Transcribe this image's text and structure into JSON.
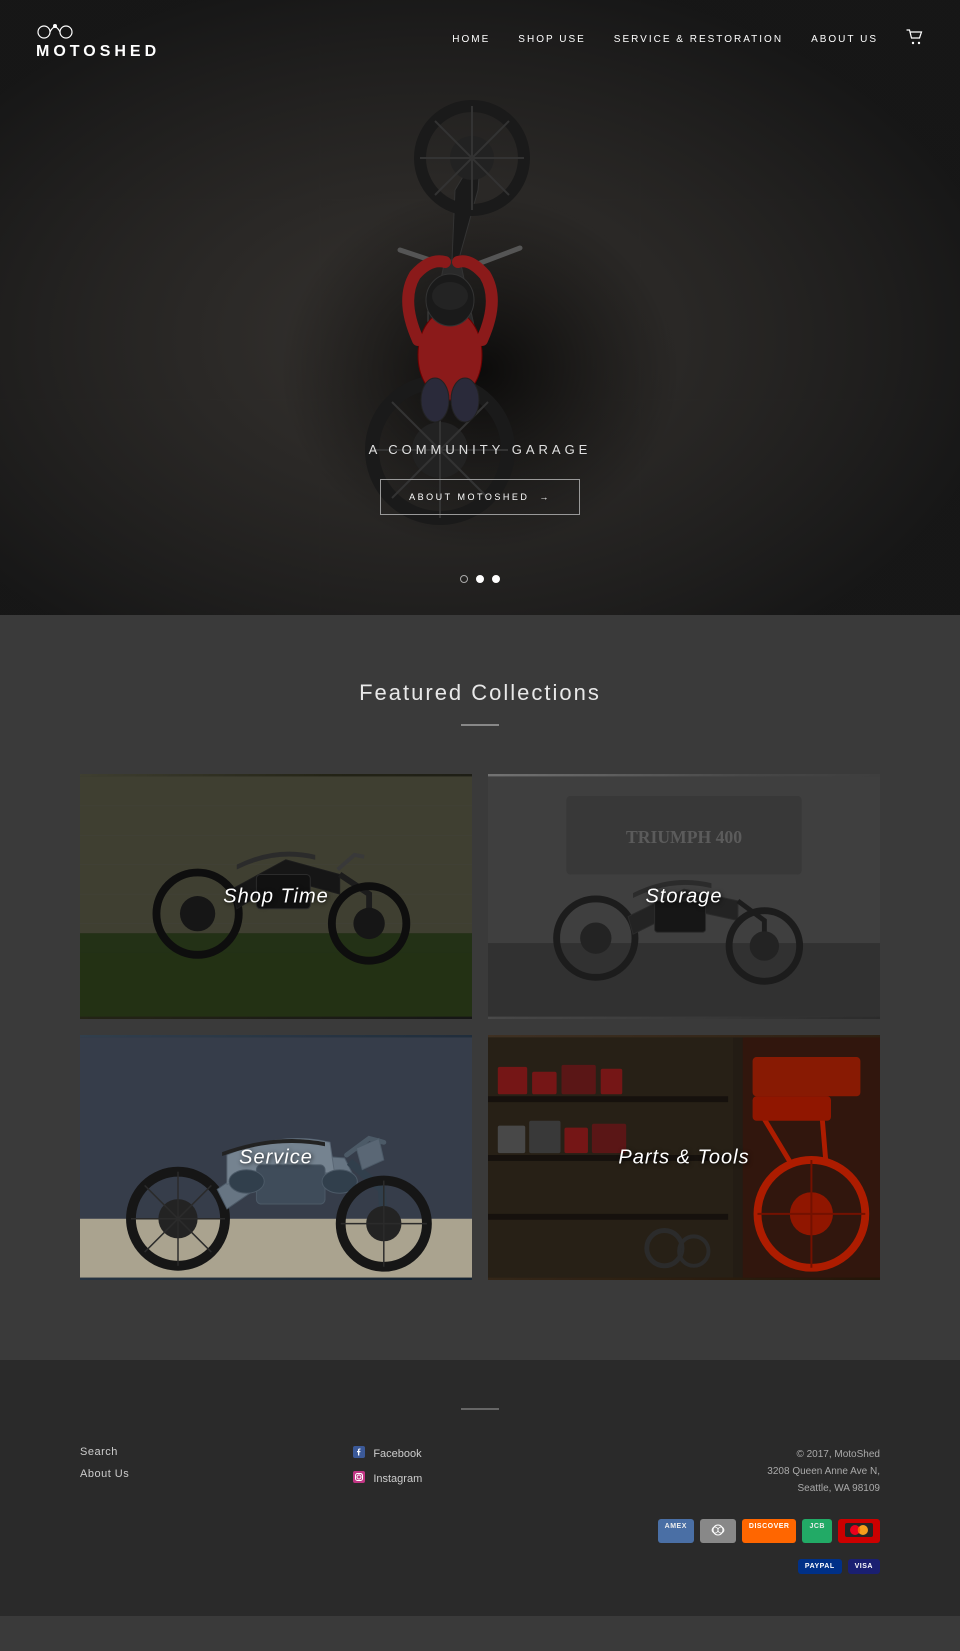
{
  "header": {
    "logo_text": "MOTOSHED",
    "nav": {
      "home": "HOME",
      "shop_use": "SHOP USE",
      "service": "SERVICE & RESTORATION",
      "about": "ABOUT US"
    }
  },
  "hero": {
    "tagline": "A COMMUNITY GARAGE",
    "cta_label": "ABOUT MOTOSHED",
    "cta_arrow": "→",
    "dots": [
      {
        "active": false
      },
      {
        "active": true
      },
      {
        "active": true
      }
    ]
  },
  "collections": {
    "section_title": "Featured Collections",
    "items": [
      {
        "label": "Shop Time",
        "key": "shop-time"
      },
      {
        "label": "Storage",
        "key": "storage"
      },
      {
        "label": "Service",
        "key": "service"
      },
      {
        "label": "Parts & Tools",
        "key": "parts-tools"
      }
    ]
  },
  "footer": {
    "links": [
      {
        "label": "Search"
      },
      {
        "label": "About Us"
      }
    ],
    "social": [
      {
        "platform": "Facebook",
        "icon": "f"
      },
      {
        "platform": "Instagram",
        "icon": "ig"
      }
    ],
    "copyright": "© 2017, MotoShed",
    "address_line1": "3208 Queen Anne Ave N,",
    "address_line2": "Seattle, WA 98109",
    "payment_methods": [
      "AMEX",
      "DINERS",
      "DISCOVER",
      "JCB",
      "MASTER",
      "PAYPAL",
      "VISA"
    ]
  }
}
